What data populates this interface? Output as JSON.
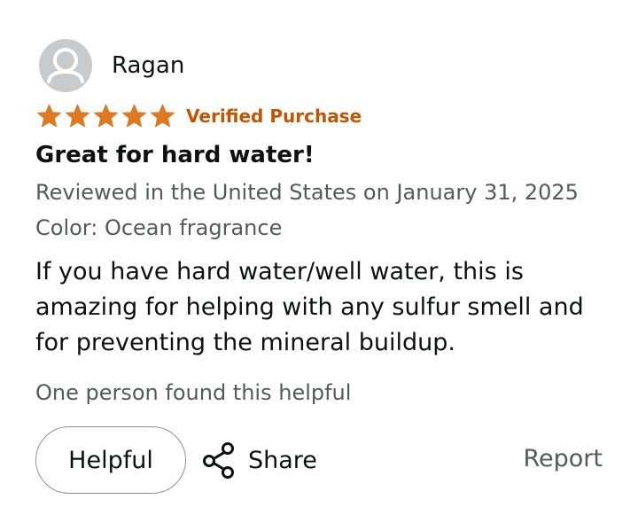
{
  "reviewer": {
    "name": "Ragan",
    "avatar_icon": "user-silhouette-icon"
  },
  "rating": {
    "stars": 5,
    "max_stars": 5,
    "star_color": "#de7921",
    "verified_label": "Verified Purchase",
    "verified_color": "#c45500"
  },
  "review": {
    "title": "Great for hard water!",
    "date_line": "Reviewed in the United States on January 31, 2025",
    "color_line": "Color: Ocean fragrance",
    "body": "If you have hard water/well water, this is amazing for helping with any sulfur smell and for preventing the mineral buildup."
  },
  "footer": {
    "helpful_count": "One person found this helpful",
    "helpful_label": "Helpful",
    "share_label": "Share",
    "share_icon": "share-icon",
    "report_label": "Report"
  }
}
